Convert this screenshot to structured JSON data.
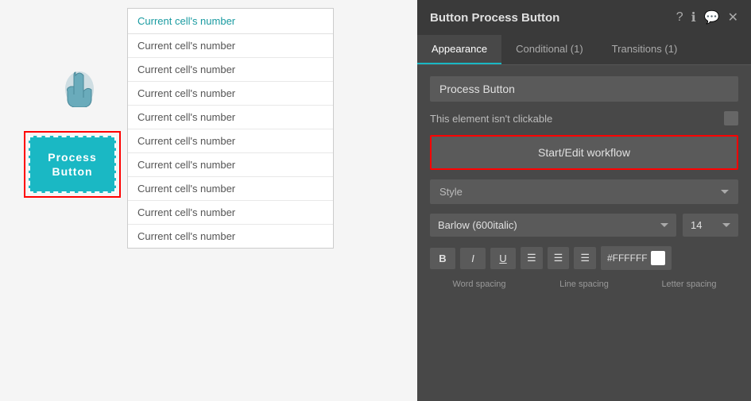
{
  "panel": {
    "title": "Button Process Button",
    "tabs": [
      {
        "label": "Appearance",
        "active": true
      },
      {
        "label": "Conditional (1)",
        "active": false
      },
      {
        "label": "Transitions (1)",
        "active": false
      }
    ],
    "appearance": {
      "button_name": "Process Button",
      "clickable_label": "This element isn't clickable",
      "workflow_button": "Start/Edit workflow",
      "style_label": "Style",
      "font_name": "Barlow (600italic)",
      "font_size": "14",
      "color_hex": "#FFFFFF",
      "word_spacing": "Word spacing",
      "line_spacing": "Line spacing",
      "letter_spacing": "Letter spacing"
    }
  },
  "table": {
    "header": "Current cell's number",
    "rows": [
      "Current cell's number",
      "Current cell's number",
      "Current cell's number",
      "Current cell's number",
      "Current cell's number",
      "Current cell's number",
      "Current cell's number",
      "Current cell's number",
      "Current cell's number"
    ]
  },
  "widget": {
    "label_line1": "Process",
    "label_line2": "Button"
  },
  "header_icons": {
    "help": "?",
    "info": "ℹ",
    "chat": "💬",
    "close": "✕"
  }
}
